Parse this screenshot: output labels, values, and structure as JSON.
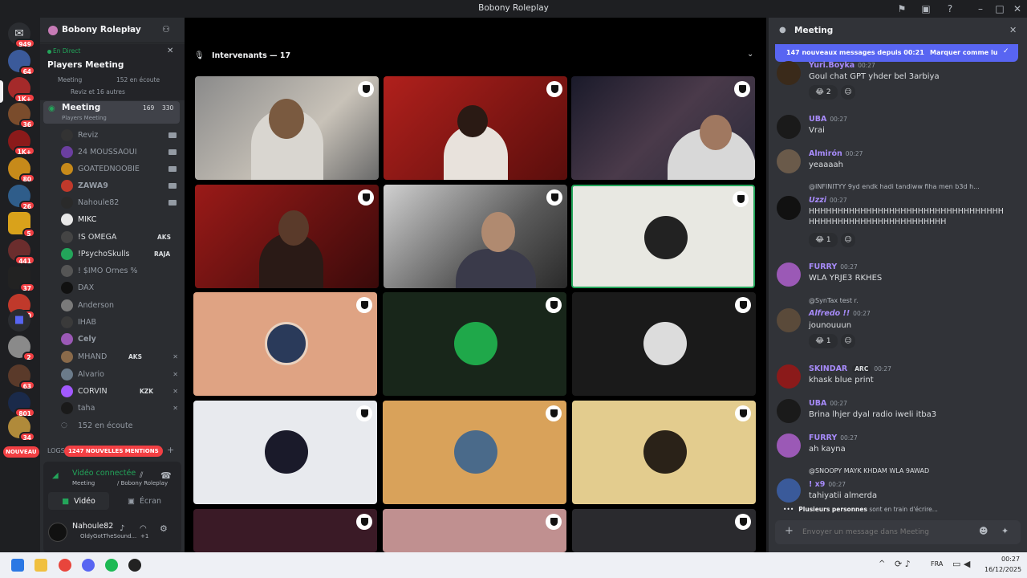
{
  "window": {
    "title": "Bobony Roleplay"
  },
  "servers": {
    "badges": [
      "949",
      "64",
      "1K+",
      "36",
      "1K+",
      "80",
      "26",
      "5",
      "441",
      "37",
      "10",
      "2",
      "63",
      "801",
      "34"
    ],
    "new_label": "NOUVEAU"
  },
  "sidebar": {
    "server_name": "Bobony Roleplay",
    "live_label": "En Direct",
    "event_title": "Players Meeting",
    "event_sub": "Meeting",
    "listening": "152 en écoute",
    "attendees": "Reviz et 16 autres",
    "voice_channel": {
      "name": "Meeting",
      "count_a": "169",
      "count_b": "330",
      "sub": "Players Meeting"
    },
    "members": [
      "Reviz",
      "24 MOUSSAOUI",
      "GOATEDNOOBIE",
      "ZAWA9",
      "Nahoule82",
      "MIKC",
      "!S OMEGA",
      "!PsychoSkulls",
      "! $IMO Ornes %",
      "DAX",
      "Anderson",
      "IHAB",
      "Cely",
      "MHAND",
      "Alvario",
      "CORVIN",
      "taha"
    ],
    "tags": {
      "omega": "AKS",
      "psycho": "RAJA",
      "mhand": "AKS",
      "corvin": "KZK"
    },
    "listening_bottom": "152 en écoute",
    "logs_label": "LOGS",
    "mentions_badge": "1247 NOUVELLES MENTIONS",
    "voice_status": "Vidéo connectée",
    "voice_location": "Meeting",
    "voice_server": "/ Bobony Roleplay",
    "video_btn": "Vidéo",
    "screen_btn": "Écran",
    "user_name": "Nahoule82",
    "user_status": "OldyGotTheSound...",
    "user_extra": "+1"
  },
  "stage": {
    "header": "Intervenants — 17"
  },
  "chat": {
    "title": "Meeting",
    "new_banner": "147 nouveaux messages depuis 00:21",
    "mark_read": "Marquer comme lu",
    "messages": [
      {
        "name": "Yuri.Boyka",
        "time": "00:27",
        "text": "Goul chat GPT yhder bel 3arbiya",
        "color": "#a78bfa",
        "reaction": "2"
      },
      {
        "name": "UBA",
        "time": "00:27",
        "text": "Vrai",
        "color": "#a78bfa"
      },
      {
        "name": "Almirón",
        "time": "00:27",
        "text": "yeaaaah",
        "color": "#a78bfa"
      },
      {
        "reply": "@INFINITYY  9yd endk hadi tandiww fiha men b3d h...",
        "name": "Uzzi",
        "time": "00:27",
        "text": "HHHHHHHHHHHHHHHHHHHHHHHHHHHHHHHHHHHHHHHHHHHHHHHHHHHHHHHHHH",
        "color": "#a78bfa",
        "reaction": "1"
      },
      {
        "name": "FURRY",
        "time": "00:27",
        "text": "WLA YRJE3 RKHES",
        "color": "#a78bfa"
      },
      {
        "reply": "@SynTax test r.",
        "name": "Alfredo !!",
        "time": "00:27",
        "text": "jounouuun",
        "color": "#a78bfa",
        "reaction": "1"
      },
      {
        "name": "SKINDAR",
        "tag": "ARC",
        "time": "00:27",
        "text": "khask blue print",
        "color": "#a78bfa"
      },
      {
        "name": "UBA",
        "time": "00:27",
        "text": "Brina lhjer dyal radio iweli itba3",
        "color": "#a78bfa"
      },
      {
        "name": "FURRY",
        "time": "00:27",
        "text": "ah kayna",
        "color": "#a78bfa"
      },
      {
        "reply": "@SNOOPY MAYK KHDAM WLA 9AWAD",
        "name": "! x9",
        "time": "00:27",
        "text": "tahiyatii almerda",
        "color": "#a78bfa"
      }
    ],
    "typing_name": "Plusieurs personnes",
    "typing_text": "sont en train d'écrire...",
    "input_placeholder": "Envoyer un message dans Meeting"
  },
  "taskbar": {
    "lang": "FRA",
    "time": "00:27",
    "date": "16/12/2025"
  },
  "colors": {
    "accent": "#5865f2",
    "green": "#23a55a",
    "red": "#f23f43"
  }
}
